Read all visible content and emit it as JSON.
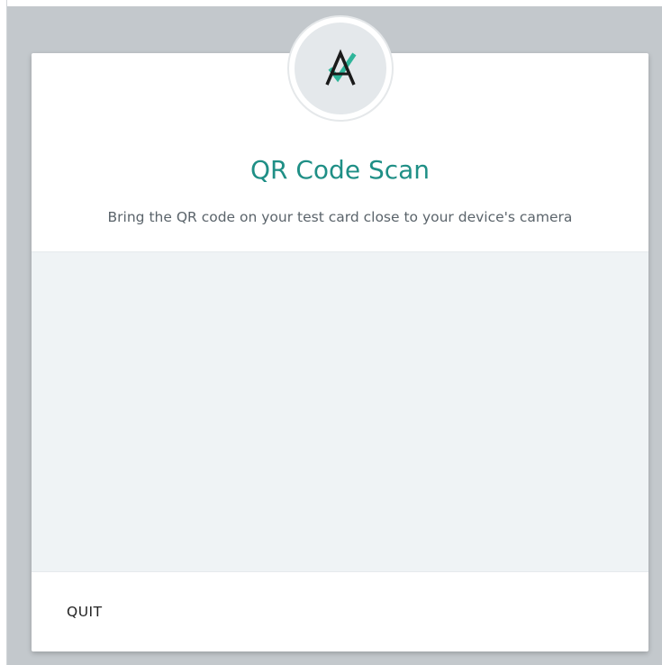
{
  "dialog": {
    "title": "QR Code Scan",
    "subtitle": "Bring the QR code on your test card close to your device's camera",
    "quit_label": "QUIT"
  },
  "logo": {
    "icon": "a-check-logo-icon",
    "letter_color": "#1a1a1a",
    "check_color": "#2fb59a"
  },
  "colors": {
    "accent": "#1f8f86",
    "camera_background": "#eff3f5",
    "page_background": "#c3c8cc"
  }
}
